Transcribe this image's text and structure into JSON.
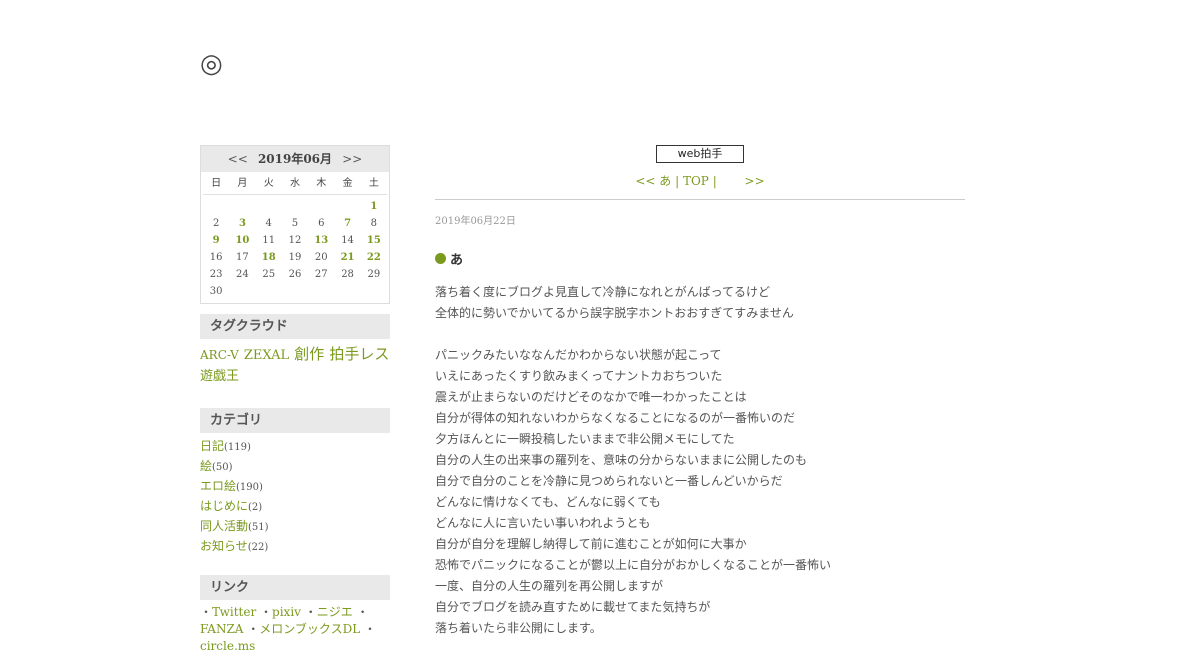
{
  "site": {
    "title": "◎"
  },
  "calendar": {
    "prev": "<<",
    "month": "2019年06月",
    "next": ">>",
    "weekdays": [
      "日",
      "月",
      "火",
      "水",
      "木",
      "金",
      "土"
    ],
    "weeks": [
      [
        {
          "d": ""
        },
        {
          "d": ""
        },
        {
          "d": ""
        },
        {
          "d": ""
        },
        {
          "d": ""
        },
        {
          "d": ""
        },
        {
          "d": "1",
          "link": true
        }
      ],
      [
        {
          "d": "2"
        },
        {
          "d": "3",
          "link": true
        },
        {
          "d": "4"
        },
        {
          "d": "5"
        },
        {
          "d": "6"
        },
        {
          "d": "7",
          "link": true
        },
        {
          "d": "8"
        }
      ],
      [
        {
          "d": "9",
          "link": true
        },
        {
          "d": "10",
          "link": true
        },
        {
          "d": "11"
        },
        {
          "d": "12"
        },
        {
          "d": "13",
          "link": true
        },
        {
          "d": "14"
        },
        {
          "d": "15",
          "link": true
        }
      ],
      [
        {
          "d": "16"
        },
        {
          "d": "17"
        },
        {
          "d": "18",
          "link": true
        },
        {
          "d": "19"
        },
        {
          "d": "20"
        },
        {
          "d": "21",
          "link": true
        },
        {
          "d": "22",
          "link": true
        }
      ],
      [
        {
          "d": "23"
        },
        {
          "d": "24"
        },
        {
          "d": "25"
        },
        {
          "d": "26"
        },
        {
          "d": "27"
        },
        {
          "d": "28"
        },
        {
          "d": "29"
        }
      ],
      [
        {
          "d": "30"
        },
        {
          "d": ""
        },
        {
          "d": ""
        },
        {
          "d": ""
        },
        {
          "d": ""
        },
        {
          "d": ""
        },
        {
          "d": ""
        }
      ]
    ]
  },
  "tagcloud": {
    "heading": "タグクラウド",
    "tags": [
      {
        "label": "ARC-V",
        "size": "sm"
      },
      {
        "label": "ZEXAL",
        "size": "md"
      },
      {
        "label": "創作",
        "size": "lg"
      },
      {
        "label": "拍手レス",
        "size": "lg"
      },
      {
        "label": "遊戯王",
        "size": "md"
      }
    ]
  },
  "categories": {
    "heading": "カテゴリ",
    "items": [
      {
        "label": "日記",
        "count": "(119)"
      },
      {
        "label": "絵",
        "count": "(50)"
      },
      {
        "label": "エロ絵",
        "count": "(190)"
      },
      {
        "label": "はじめに",
        "count": "(2)"
      },
      {
        "label": "同人活動",
        "count": "(51)"
      },
      {
        "label": "お知らせ",
        "count": "(22)"
      }
    ]
  },
  "links": {
    "heading": "リンク",
    "items": [
      "Twitter",
      "pixiv",
      "ニジエ",
      "FANZA",
      "メロンブックスDL",
      "circle.ms"
    ]
  },
  "main": {
    "clap_label": "web拍手",
    "nav_prev": "<< あ",
    "nav_sep1": " | ",
    "nav_top": "TOP",
    "nav_sep2": " | ",
    "nav_next": ">>",
    "date": "2019年06月22日",
    "entry_title": "あ",
    "body_lines": [
      "落ち着く度にブログよ見直して冷静になれとがんばってるけど",
      "全体的に勢いでかいてるから誤字脱字ホントおおすぎてすみません",
      "",
      "パニックみたいななんだかわからない状態が起こって",
      "いえにあったくすり飲みまくってナントカおちついた",
      "震えが止まらないのだけどそのなかで唯一わかったことは",
      "自分が得体の知れないわからなくなることになるのが一番怖いのだ",
      "夕方ほんとに一瞬投稿したいままで非公開メモにしてた",
      "自分の人生の出来事の羅列を、意味の分からないままに公開したのも",
      "自分で自分のことを冷静に見つめられないと一番しんどいからだ",
      "どんなに情けなくても、どんなに弱くても",
      "どんなに人に言いたい事いわれようとも",
      "自分が自分を理解し納得して前に進むことが如何に大事か",
      "恐怖でパニックになることが鬱以上に自分がおかしくなることが一番怖い",
      "一度、自分の人生の羅列を再公開しますが",
      "自分でブログを読み直すために載せてまた気持ちが",
      "落ち着いたら非公開にします。"
    ]
  },
  "colors": {
    "accent": "#7a9a1e",
    "header_bg": "#e9e9e9",
    "text": "#555555"
  }
}
